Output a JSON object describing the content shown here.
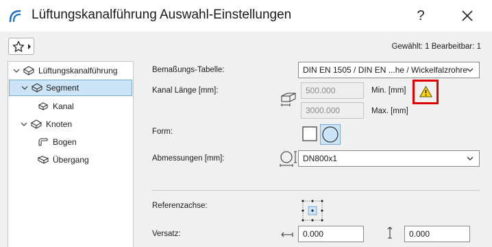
{
  "window": {
    "title": "Lüftungskanalführung Auswahl-Einstellungen",
    "help_label": "?"
  },
  "status": {
    "text": "Gewählt: 1 Bearbeitbar: 1"
  },
  "tree": {
    "items": [
      {
        "label": "Lüftungskanalführung",
        "icon": "duct-route-icon",
        "expanded": true
      },
      {
        "label": "Segment",
        "icon": "duct-segment-icon",
        "expanded": true,
        "selected": true
      },
      {
        "label": "Kanal",
        "icon": "duct-icon"
      },
      {
        "label": "Knoten",
        "icon": "duct-node-icon",
        "expanded": true
      },
      {
        "label": "Bogen",
        "icon": "elbow-icon"
      },
      {
        "label": "Übergang",
        "icon": "transition-icon"
      }
    ]
  },
  "form": {
    "table_label": "Bemaßungs-Tabelle:",
    "table_value": "DIN EN 1505 / DIN EN ...he / Wickelfalzrohre",
    "length_label": "Kanal Länge [mm]:",
    "min_value": "500.000",
    "min_label": "Min. [mm]",
    "max_value": "3000.000",
    "max_label": "Max. [mm]",
    "shape_label": "Form:",
    "shapes": [
      "rectangular",
      "circular"
    ],
    "shape_selected": "circular",
    "dimensions_label": "Abmessungen [mm]:",
    "dimensions_value": "DN800x1",
    "reference_label": "Referenzachse:",
    "offset_label": "Versatz:",
    "offset_h_value": "0.000",
    "offset_v_value": "0.000"
  },
  "colors": {
    "selection_bg": "#cce4f7",
    "selection_border": "#7aa7d8",
    "warning_highlight": "#e00000",
    "warning_fill": "#ffd400",
    "app_icon": "#1b6fc2"
  }
}
